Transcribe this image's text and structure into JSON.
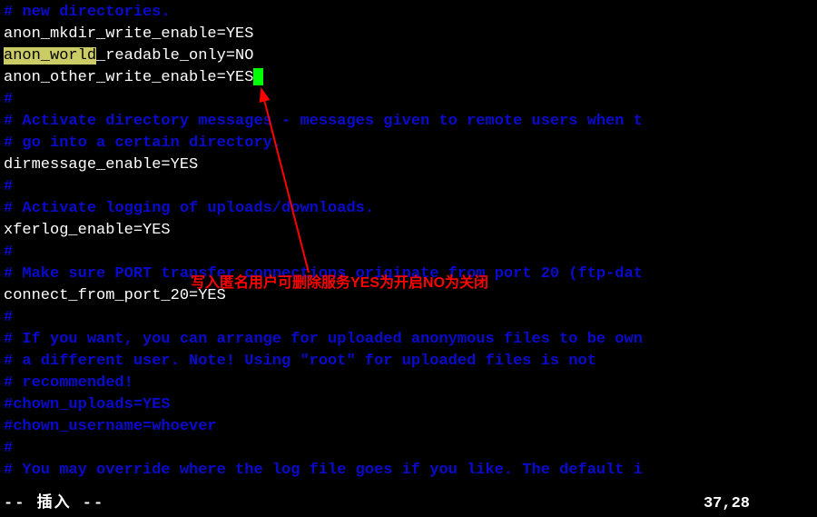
{
  "lines": {
    "l1": "# new directories.",
    "l2": "anon_mkdir_write_enable=YES",
    "l3a": "anon_world",
    "l3b": "_readable_only=NO",
    "l4": "anon_other_write_enable=YES",
    "l5": "#",
    "l6": "# Activate directory messages - messages given to remote users when t",
    "l7": "# go into a certain directory.",
    "l8": "dirmessage_enable=YES",
    "l9": "#",
    "l10": "# Activate logging of uploads/downloads.",
    "l11": "xferlog_enable=YES",
    "l12": "#",
    "l13": "# Make sure PORT transfer connections originate from port 20 (ftp-dat",
    "l14": "connect_from_port_20=YES",
    "l15": "#",
    "l16": "# If you want, you can arrange for uploaded anonymous files to be own",
    "l17": "# a different user. Note! Using \"root\" for uploaded files is not",
    "l18": "# recommended!",
    "l19": "#chown_uploads=YES",
    "l20": "#chown_username=whoever",
    "l21": "#",
    "l22": "# You may override where the log file goes if you like. The default i"
  },
  "status": {
    "mode": "-- 插入 --",
    "position": "37,28"
  },
  "annotation": {
    "text": "写入匿名用户可删除服务YES为开启NO为关闭"
  }
}
